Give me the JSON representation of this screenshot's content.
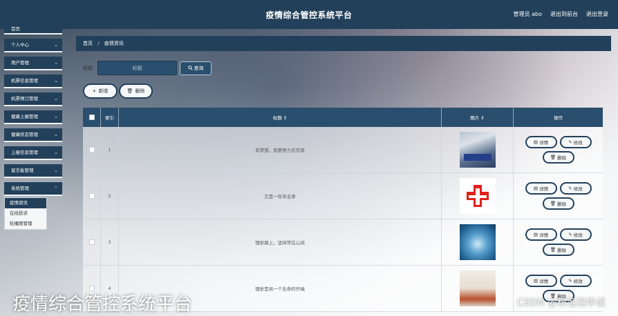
{
  "header": {
    "title": "疫情综合管控系统平台",
    "admin_label": "管理员 abo",
    "back_label": "退出到前台",
    "logout_label": "退出登录"
  },
  "sidebar": {
    "items": [
      {
        "label": "首页"
      },
      {
        "label": "个人中心"
      },
      {
        "label": "用户管理"
      },
      {
        "label": "机票信息管理"
      },
      {
        "label": "机票预订管理"
      },
      {
        "label": "健康上报管理"
      },
      {
        "label": "健康状态管理"
      },
      {
        "label": "上报信息管理"
      },
      {
        "label": "留言板管理"
      },
      {
        "label": "系统管理"
      }
    ],
    "submenu": [
      {
        "label": "疫情资讯",
        "active": true
      },
      {
        "label": "在线投诉",
        "active": false
      },
      {
        "label": "轮播图管理",
        "active": false
      }
    ]
  },
  "breadcrumb": {
    "home": "首页",
    "separator": "/",
    "current": "疫情资讯"
  },
  "search": {
    "label": "标题",
    "placeholder": "标题",
    "button": "查询"
  },
  "actions": {
    "add": "新增",
    "delete": "删除"
  },
  "table": {
    "headers": {
      "index": "索引",
      "title": "标题 ⇕",
      "image": "图片 ⇕",
      "ops": "操作"
    },
    "rows": [
      {
        "index": "1",
        "title": "有梦想，就要努力去实现",
        "image": "hospital-ward"
      },
      {
        "index": "2",
        "title": "又是一年毕业季",
        "image": "red-cross"
      },
      {
        "index": "3",
        "title": "理折路上，坚持常在心间",
        "image": "ambulance-interior"
      },
      {
        "index": "4",
        "title": "理折是另一个生命的开端",
        "image": "clinic-corridor"
      }
    ],
    "op_labels": {
      "detail": "详情",
      "edit": "修改",
      "delete": "删除"
    }
  },
  "caption": "疫情综合管控系统平台",
  "watermark": "CSDN @粉泡泡毕设",
  "colors": {
    "primary": "#22405a",
    "accent": "#2a4f6e"
  }
}
